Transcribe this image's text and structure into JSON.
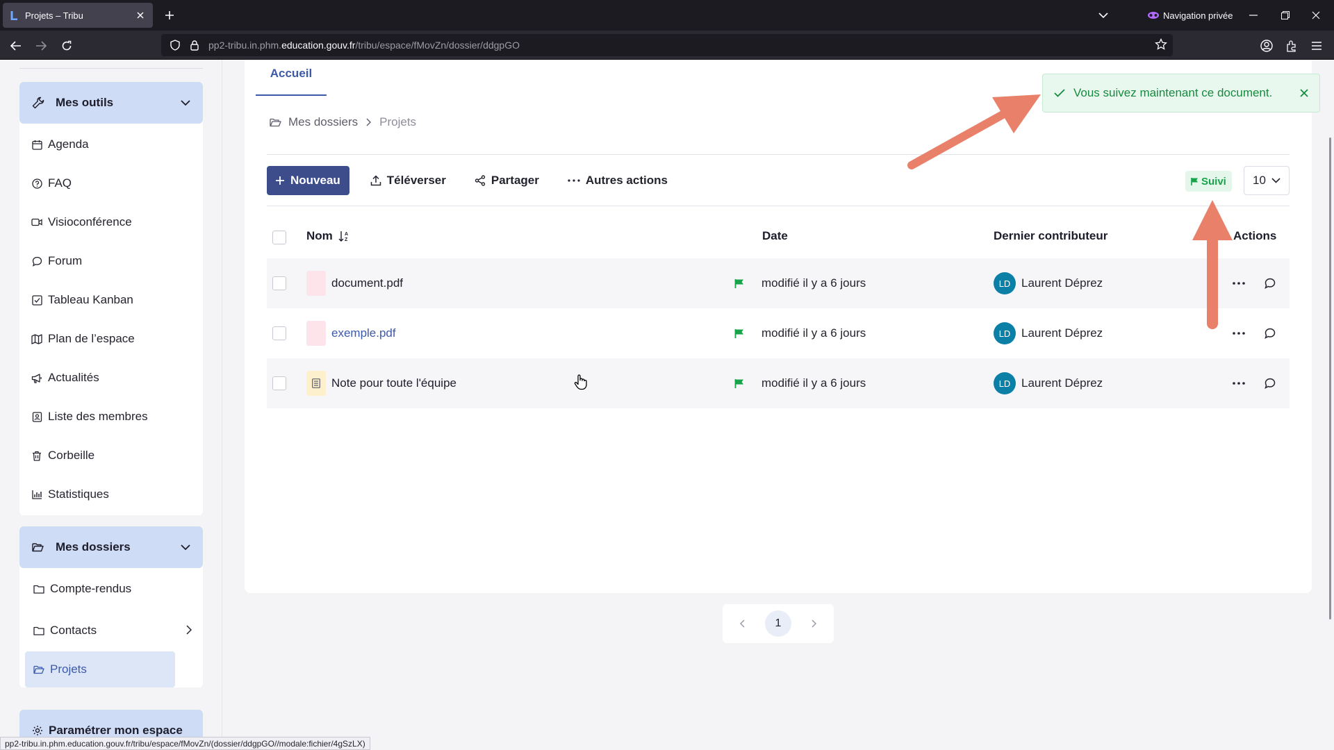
{
  "browser": {
    "tab_title": "Projets – Tribu",
    "private_label": "Navigation privée",
    "url_prefix": "pp2-tribu.in.phm.",
    "url_domain": "education.gouv.fr",
    "url_path": "/tribu/espace/fMovZn/dossier/ddgpGO"
  },
  "sidebar": {
    "tools_header": "Mes outils",
    "tools": [
      {
        "label": "Agenda",
        "icon": "calendar-icon"
      },
      {
        "label": "FAQ",
        "icon": "help-circle-icon"
      },
      {
        "label": "Visioconférence",
        "icon": "video-icon"
      },
      {
        "label": "Forum",
        "icon": "chat-icon"
      },
      {
        "label": "Tableau Kanban",
        "icon": "checkbox-icon"
      },
      {
        "label": "Plan de l’espace",
        "icon": "map-icon"
      },
      {
        "label": "Actualités",
        "icon": "megaphone-icon"
      },
      {
        "label": "Liste des membres",
        "icon": "members-icon"
      },
      {
        "label": "Corbeille",
        "icon": "trash-icon"
      },
      {
        "label": "Statistiques",
        "icon": "chart-icon"
      }
    ],
    "folders_header": "Mes dossiers",
    "folders": [
      {
        "label": "Compte-rendus"
      },
      {
        "label": "Contacts"
      },
      {
        "label": "Projets"
      }
    ],
    "settings_label": "Paramétrer mon espace"
  },
  "main": {
    "tab_label": "Accueil",
    "breadcrumb": {
      "root": "Mes dossiers",
      "current": "Projets"
    },
    "toolbar": {
      "new_label": "Nouveau",
      "upload_label": "Téléverser",
      "share_label": "Partager",
      "more_label": "Autres actions"
    },
    "filter_badge": "Suivi",
    "per_page": "10",
    "columns": {
      "name": "Nom",
      "date": "Date",
      "contributor": "Dernier contributeur",
      "actions": "Actions"
    },
    "rows": [
      {
        "name": "document.pdf",
        "date": "modifié il y a 6 jours",
        "initials": "LD",
        "contributor": "Laurent Déprez"
      },
      {
        "name": "exemple.pdf",
        "date": "modifié il y a 6 jours",
        "initials": "LD",
        "contributor": "Laurent Déprez"
      },
      {
        "name": "Note pour toute l'équipe",
        "date": "modifié il y a 6 jours",
        "initials": "LD",
        "contributor": "Laurent Déprez"
      }
    ],
    "pagination": {
      "current": "1"
    }
  },
  "toast": {
    "message": "Vous suivez maintenant ce document."
  },
  "status_url": "pp2-tribu.in.phm.education.gouv.fr/tribu/espace/fMovZn/(dossier/ddgpGO//modale:fichier/4gSzLX)",
  "colors": {
    "primary": "#3d4d8c",
    "accent": "#3d5aa8",
    "success": "#16a34a",
    "annotation_arrow": "#e8806a",
    "avatar": "#0b7fa6"
  }
}
